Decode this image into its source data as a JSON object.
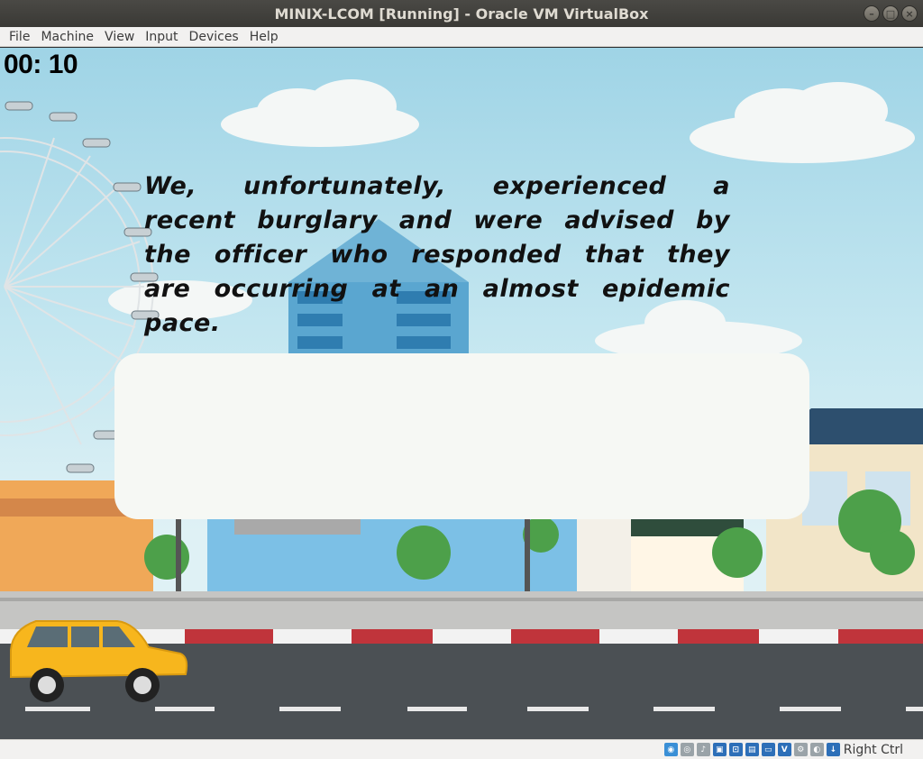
{
  "window": {
    "title": "MINIX-LCOM [Running] - Oracle VM VirtualBox",
    "buttons": [
      "minimize",
      "maximize",
      "close"
    ]
  },
  "menu": [
    "File",
    "Machine",
    "View",
    "Input",
    "Devices",
    "Help"
  ],
  "game": {
    "timer": "00: 10",
    "phrase": "We, unfortunately, experienced a recent burglary and were advised by the officer who responded that they are occurring at an almost epidemic pace.",
    "typed_text": ""
  },
  "statusbar": {
    "icons": [
      "hard-disk-icon",
      "optical-drive-icon",
      "audio-icon",
      "network-icon",
      "usb-icon",
      "shared-folders-icon",
      "display-icon",
      "recording-icon",
      "virtualization-icon",
      "mouse-integration-icon",
      "keyboard-icon"
    ],
    "host_key": "Right Ctrl"
  },
  "colors": {
    "sky": "#a8d8e8",
    "road": "#4a4f52",
    "car": "#f5b820",
    "input_box": "#f6f8f4"
  }
}
